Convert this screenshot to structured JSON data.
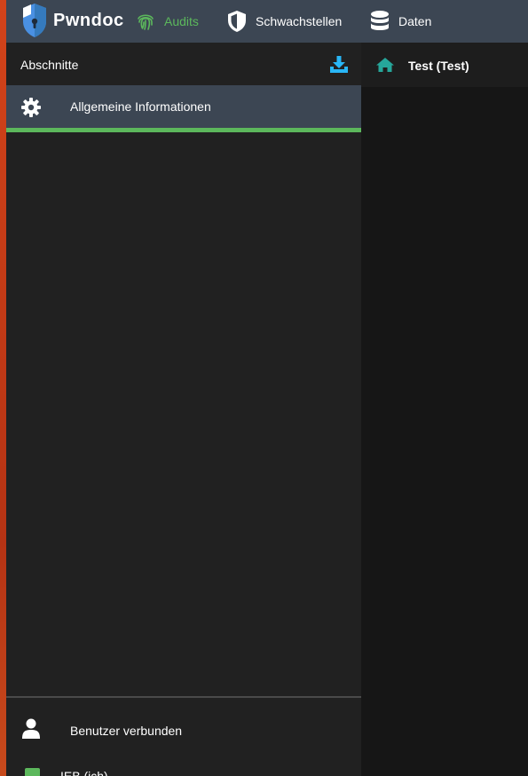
{
  "app": {
    "brand": "Pwndoc"
  },
  "nav": {
    "audits": "Audits",
    "vulnerabilities": "Schwachstellen",
    "data": "Daten"
  },
  "colors": {
    "accent": "#5cb85c",
    "download": "#29b6f6",
    "home": "#26a69a",
    "topbar": "#3c4653"
  },
  "sidebar": {
    "sections_title": "Abschnitte",
    "sections": [
      {
        "label": "Allgemeine Informationen",
        "icon": "gear-icon"
      }
    ],
    "progress_percent": 100,
    "users_title": "Benutzer verbunden",
    "users": [
      {
        "name": "IEB (ich)"
      }
    ]
  },
  "breadcrumb": {
    "title": "Test (Test)"
  }
}
